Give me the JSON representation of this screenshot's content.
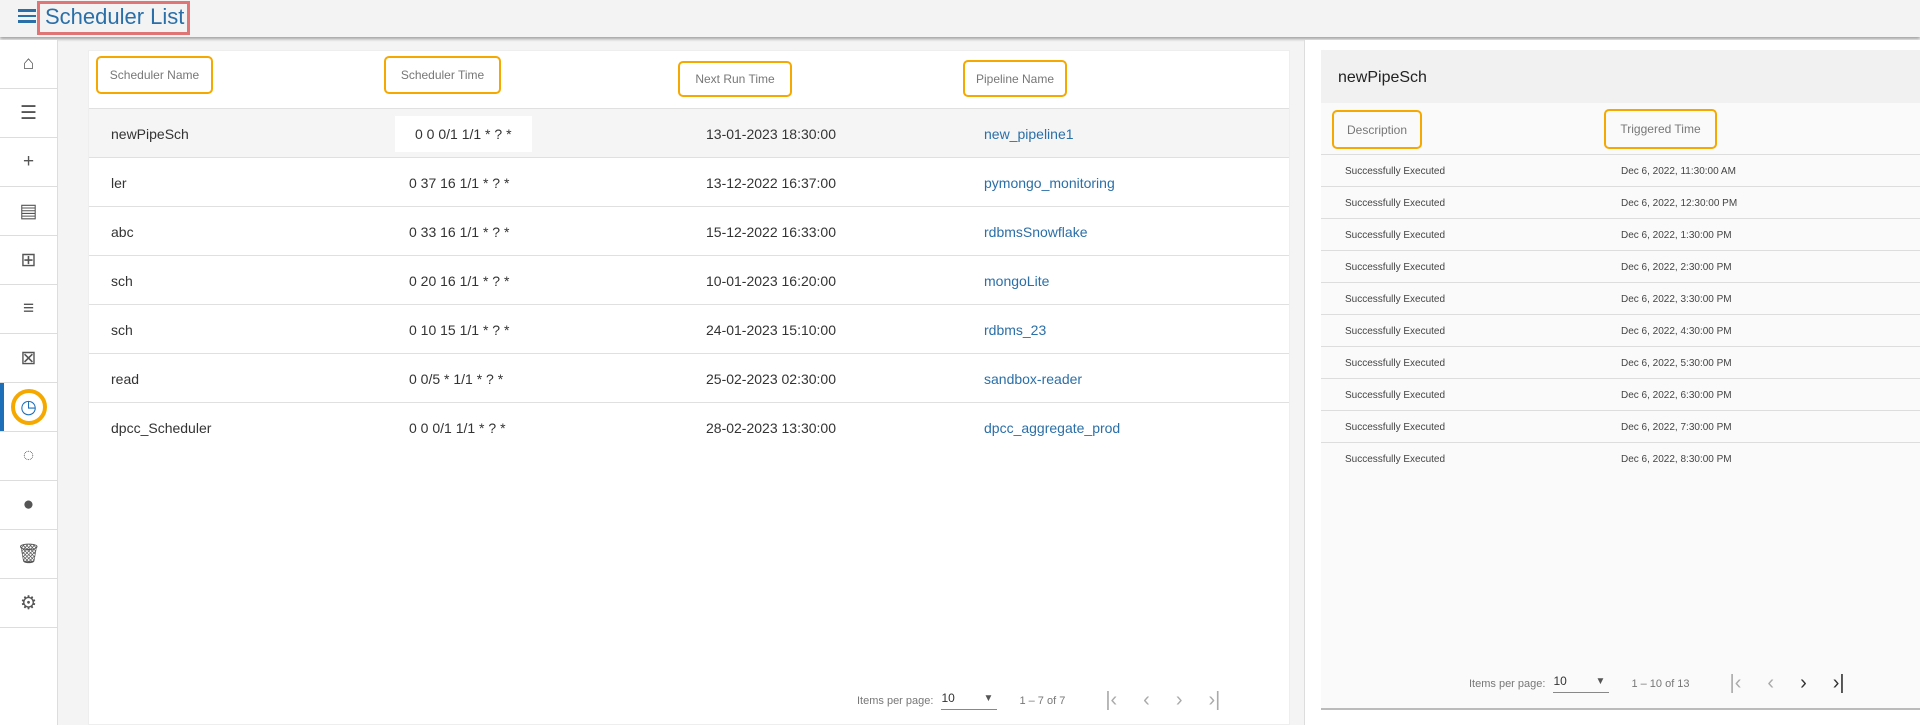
{
  "header": {
    "title": "Scheduler List",
    "menu_icon": "hamburger-icon"
  },
  "sidebar": {
    "items": [
      {
        "icon": "home-icon",
        "glyph": "⌂"
      },
      {
        "icon": "list-icon",
        "glyph": "☰"
      },
      {
        "icon": "plus-icon",
        "glyph": "+"
      },
      {
        "icon": "library-books-icon",
        "glyph": "▤"
      },
      {
        "icon": "library-add-icon",
        "glyph": "⊞"
      },
      {
        "icon": "playlist-icon",
        "glyph": "≡"
      },
      {
        "icon": "delete-box-icon",
        "glyph": "⊠"
      },
      {
        "icon": "clock-icon",
        "glyph": "◷",
        "active": true
      },
      {
        "icon": "progress-circle-icon",
        "glyph": "◌"
      },
      {
        "icon": "group-circle-icon",
        "glyph": "●"
      },
      {
        "icon": "trash-icon",
        "glyph": "🗑"
      },
      {
        "icon": "settings-icon",
        "glyph": "⚙"
      }
    ]
  },
  "table": {
    "columns": [
      "Scheduler Name",
      "Scheduler Time",
      "Next Run Time",
      "Pipeline Name"
    ],
    "rows": [
      {
        "name": "newPipeSch",
        "time": "0 0 0/1 1/1 * ? *",
        "next": "13-01-2023 18:30:00",
        "pipeline": "new_pipeline1"
      },
      {
        "name": "ler",
        "time": "0 37 16 1/1 * ? *",
        "next": "13-12-2022 16:37:00",
        "pipeline": "pymongo_monitoring"
      },
      {
        "name": "abc",
        "time": "0 33 16 1/1 * ? *",
        "next": "15-12-2022 16:33:00",
        "pipeline": "rdbmsSnowflake"
      },
      {
        "name": "sch",
        "time": "0 20 16 1/1 * ? *",
        "next": "10-01-2023 16:20:00",
        "pipeline": "mongoLite"
      },
      {
        "name": "sch",
        "time": "0 10 15 1/1 * ? *",
        "next": "24-01-2023 15:10:00",
        "pipeline": "rdbms_23"
      },
      {
        "name": "read",
        "time": "0 0/5 * 1/1 * ? *",
        "next": "25-02-2023 02:30:00",
        "pipeline": "sandbox-reader"
      },
      {
        "name": "dpcc_Scheduler",
        "time": "0 0 0/1 1/1 * ? *",
        "next": "28-02-2023 13:30:00",
        "pipeline": "dpcc_aggregate_prod"
      }
    ],
    "pagination": {
      "label": "Items per page:",
      "per_page": "10",
      "range": "1 – 7 of 7"
    }
  },
  "detail": {
    "title": "newPipeSch",
    "columns": [
      "Description",
      "Triggered Time"
    ],
    "rows": [
      {
        "desc": "Successfully Executed",
        "time": "Dec 6, 2022, 11:30:00 AM"
      },
      {
        "desc": "Successfully Executed",
        "time": "Dec 6, 2022, 12:30:00 PM"
      },
      {
        "desc": "Successfully Executed",
        "time": "Dec 6, 2022, 1:30:00 PM"
      },
      {
        "desc": "Successfully Executed",
        "time": "Dec 6, 2022, 2:30:00 PM"
      },
      {
        "desc": "Successfully Executed",
        "time": "Dec 6, 2022, 3:30:00 PM"
      },
      {
        "desc": "Successfully Executed",
        "time": "Dec 6, 2022, 4:30:00 PM"
      },
      {
        "desc": "Successfully Executed",
        "time": "Dec 6, 2022, 5:30:00 PM"
      },
      {
        "desc": "Successfully Executed",
        "time": "Dec 6, 2022, 6:30:00 PM"
      },
      {
        "desc": "Successfully Executed",
        "time": "Dec 6, 2022, 7:30:00 PM"
      },
      {
        "desc": "Successfully Executed",
        "time": "Dec 6, 2022, 8:30:00 PM"
      }
    ],
    "pagination": {
      "label": "Items per page:",
      "per_page": "10",
      "range": "1 – 10 of 13"
    }
  },
  "colors": {
    "accent": "#2a6fa8",
    "highlight": "#f5a800",
    "title_box": "#e07575"
  }
}
